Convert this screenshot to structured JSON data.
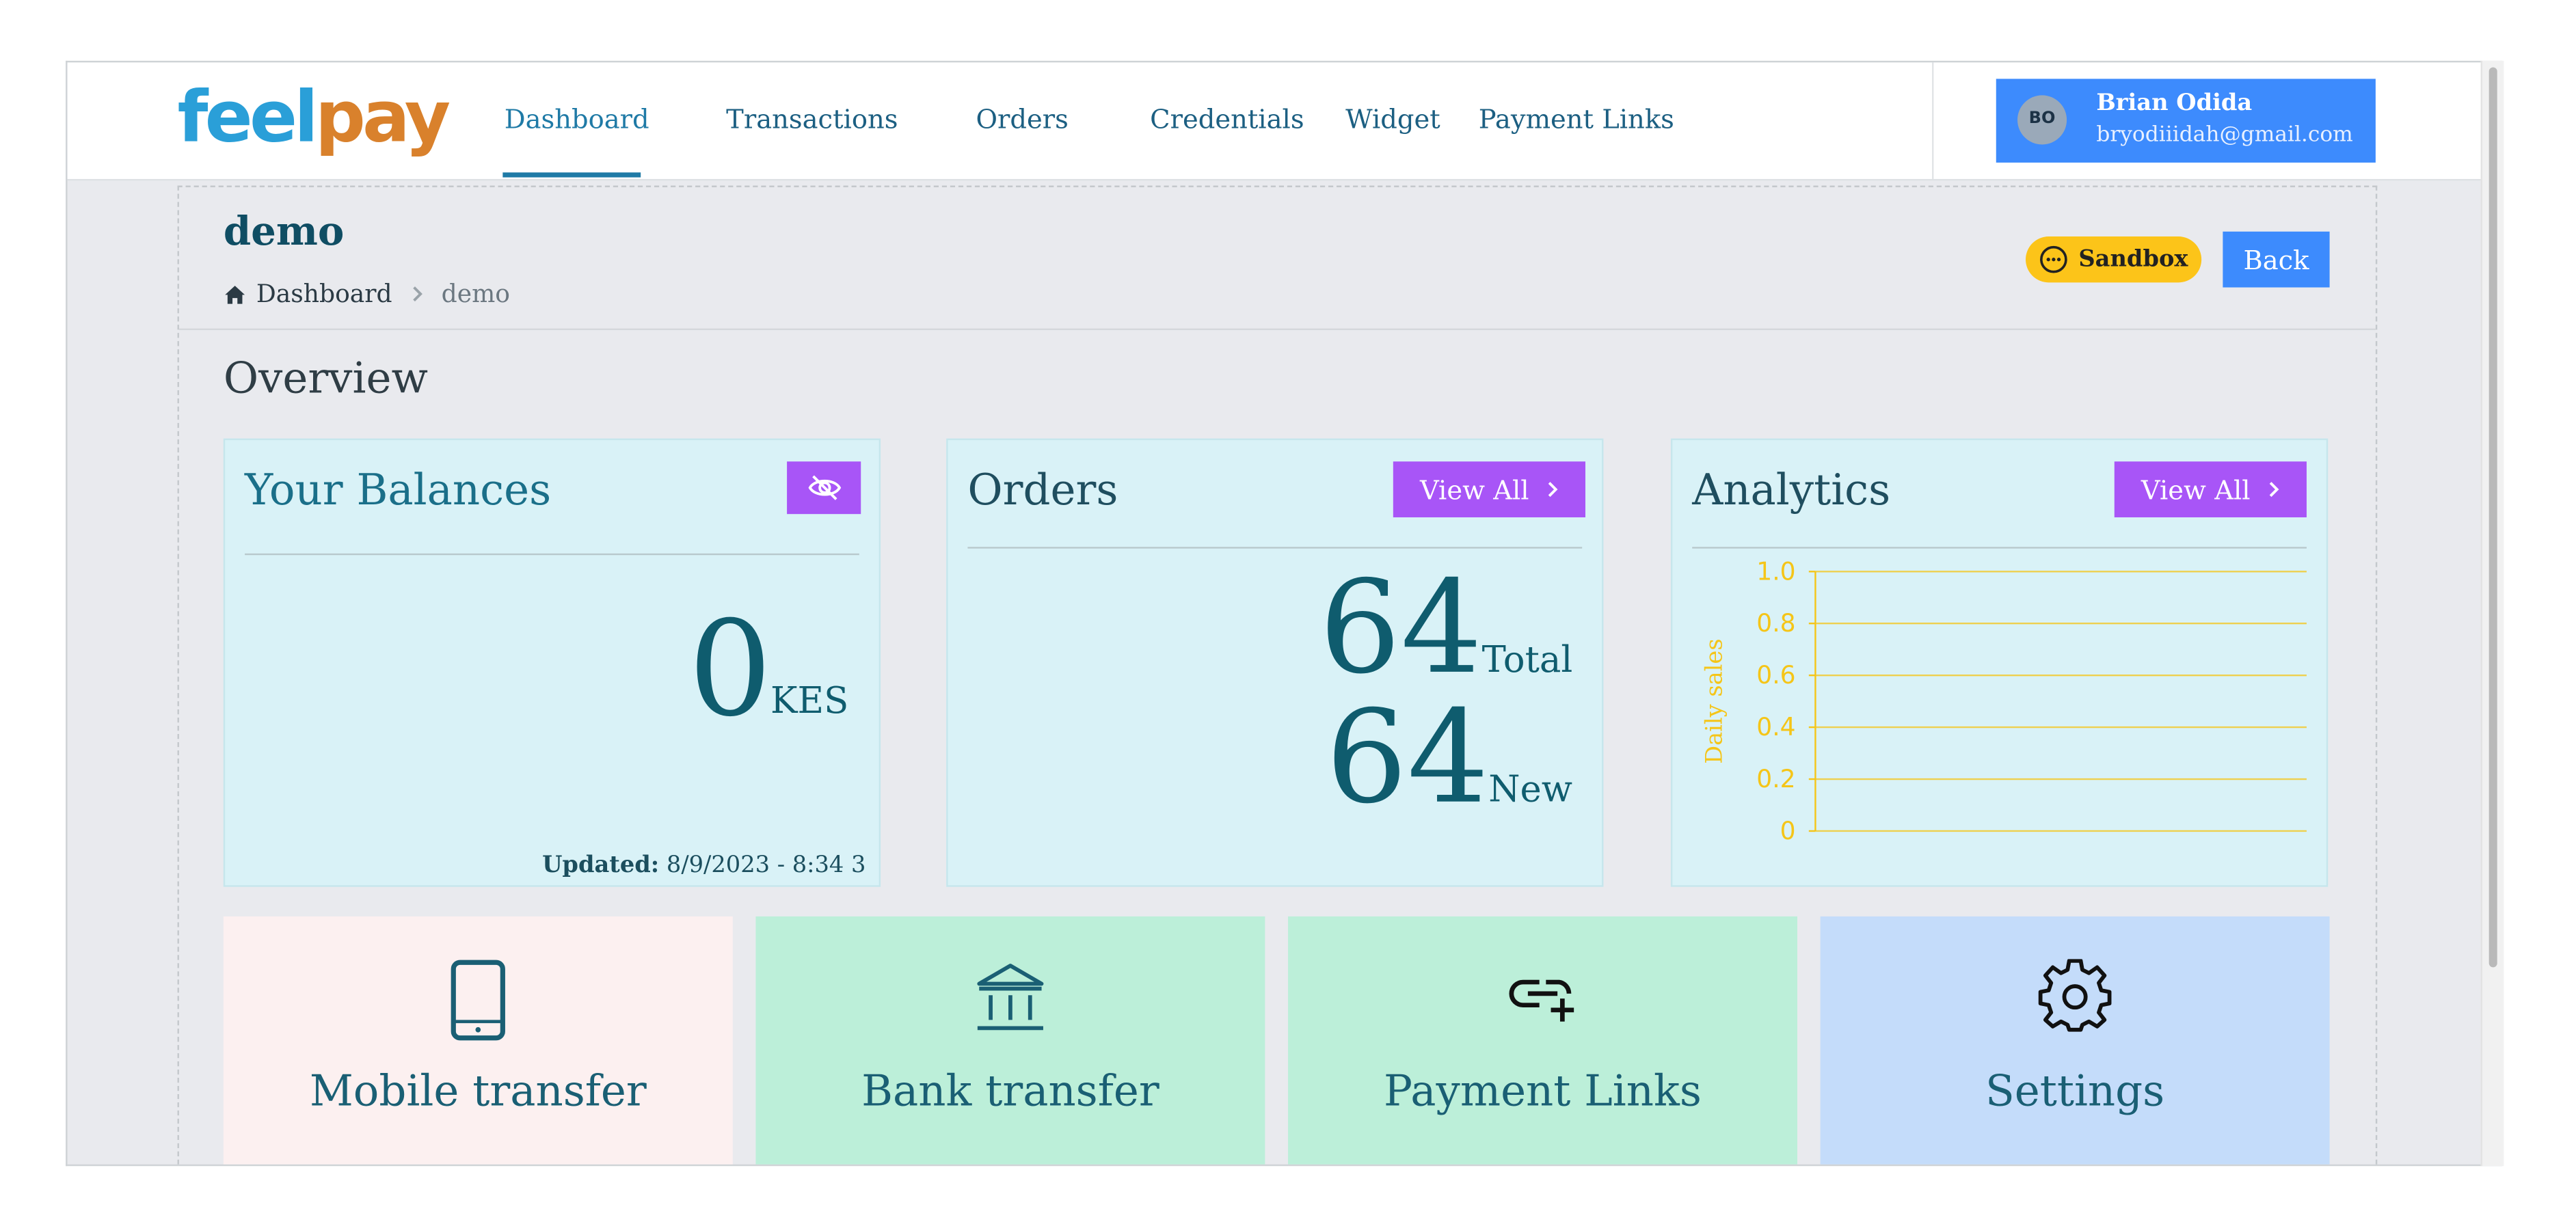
{
  "logo": {
    "part1": "feel",
    "part2": "pay"
  },
  "nav": {
    "items": [
      {
        "label": "Dashboard",
        "active": true
      },
      {
        "label": "Transactions"
      },
      {
        "label": "Orders"
      },
      {
        "label": "Credentials"
      },
      {
        "label": "Widget"
      },
      {
        "label": "Payment Links"
      }
    ]
  },
  "user": {
    "initials": "BO",
    "name": "Brian Odida",
    "email": "bryodiiidah@gmail.com"
  },
  "page": {
    "title": "demo",
    "breadcrumb": {
      "home": "Dashboard",
      "current": "demo"
    },
    "sandbox_label": "Sandbox",
    "back_label": "Back",
    "section_title": "Overview"
  },
  "balances": {
    "title": "Your Balances",
    "amount": "0",
    "currency": "KES",
    "updated_label": "Updated:",
    "updated_value": "8/9/2023 - 8:34 3"
  },
  "orders": {
    "title": "Orders",
    "view_all": "View All",
    "total_value": "64",
    "total_label": "Total",
    "new_value": "64",
    "new_label": "New"
  },
  "analytics": {
    "title": "Analytics",
    "view_all": "View All"
  },
  "chart_data": {
    "type": "line",
    "ylabel": "Daily sales",
    "ylim": [
      0,
      1.0
    ],
    "yticks": [
      "1.0",
      "0.8",
      "0.6",
      "0.4",
      "0.2",
      "0"
    ],
    "series": [],
    "grid": true,
    "color": "#f5c518"
  },
  "tiles": [
    {
      "label": "Mobile transfer",
      "icon": "mobile-phone-icon",
      "bg": "#fcf0f0"
    },
    {
      "label": "Bank transfer",
      "icon": "bank-icon",
      "bg": "#bcefd9"
    },
    {
      "label": "Payment Links",
      "icon": "link-add-icon",
      "bg": "#bcefd9"
    },
    {
      "label": "Settings",
      "icon": "gear-icon",
      "bg": "#c4dcfa"
    }
  ],
  "colors": {
    "brand_blue": "#2a9fd8",
    "brand_orange": "#d9812c",
    "accent_purple": "#a855f7",
    "primary": "#3d8bfd",
    "sandbox": "#fcc419"
  }
}
